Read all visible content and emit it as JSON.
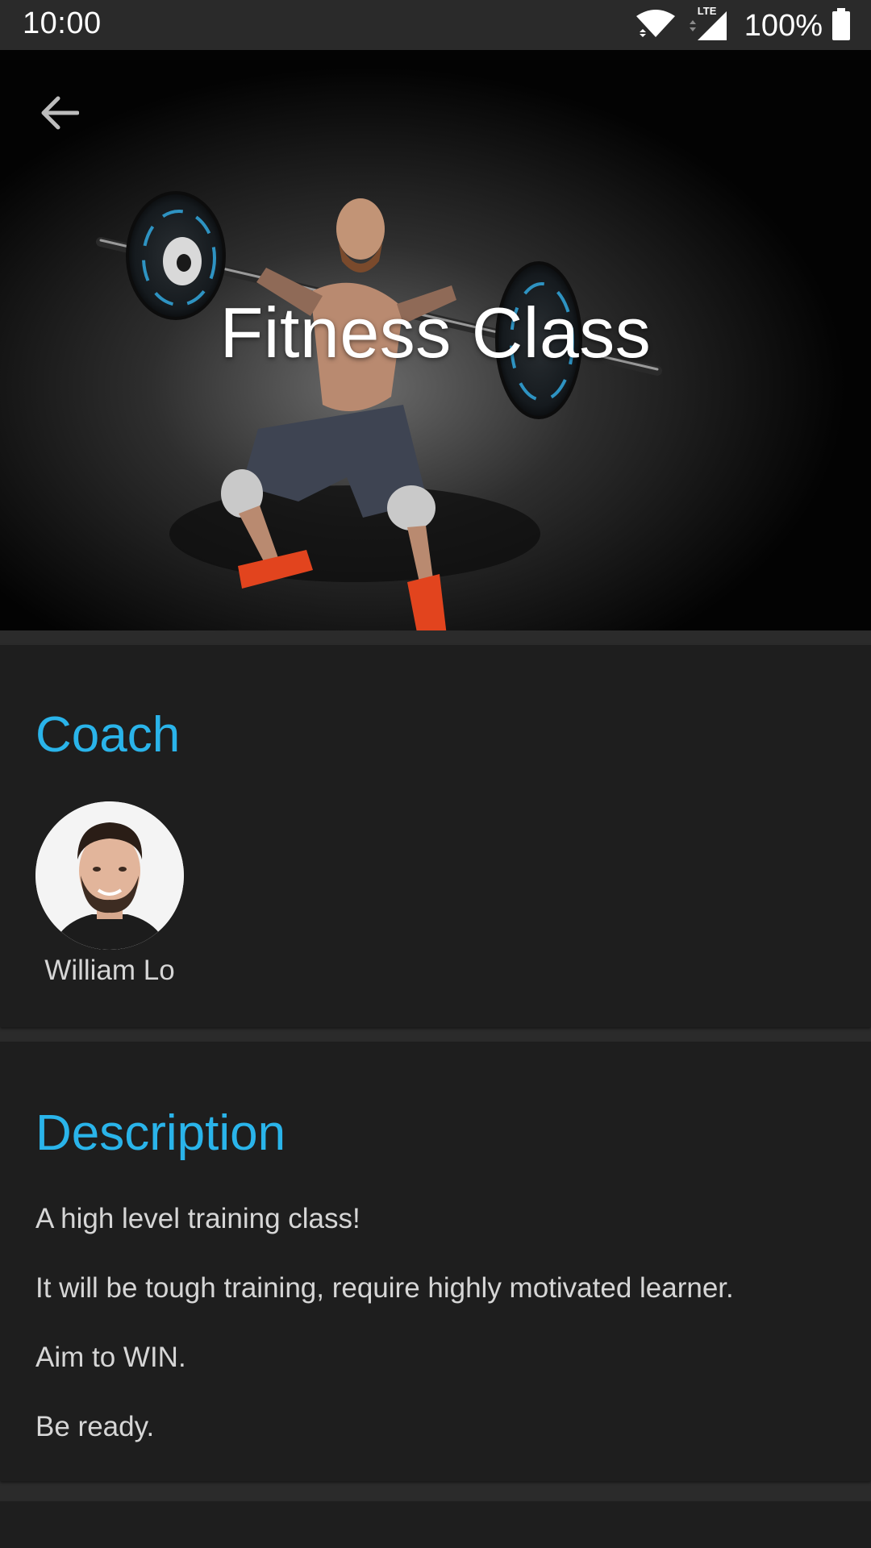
{
  "status_bar": {
    "time": "10:00",
    "network": "LTE",
    "battery": "100%",
    "icons": [
      "wifi-icon",
      "signal-icon",
      "battery-icon"
    ]
  },
  "header": {
    "back_icon": "arrow-back-icon",
    "title": "Fitness Class"
  },
  "coach_section": {
    "heading": "Coach",
    "coaches": [
      {
        "name": "William Lo"
      }
    ]
  },
  "description_section": {
    "heading": "Description",
    "lines": [
      "A high level training class!",
      "It will be tough training, require highly motivated learner.",
      "Aim to WIN.",
      "Be ready."
    ]
  },
  "colors": {
    "accent": "#2ab4ea",
    "card_background": "#1e1e1e",
    "page_background": "#2b2b2b",
    "body_text": "#d6d6d6"
  }
}
